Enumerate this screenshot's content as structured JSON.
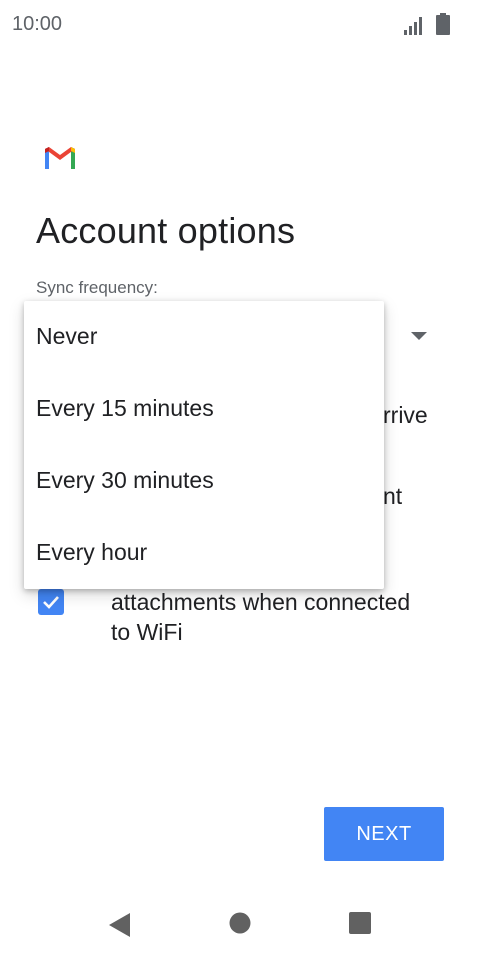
{
  "status_bar": {
    "time": "10:00"
  },
  "page": {
    "title": "Account options",
    "sync_label": "Sync frequency:"
  },
  "background": {
    "fragment_1": "rrive",
    "fragment_2": "nt",
    "checkbox_line_1": "attachments when connected",
    "checkbox_line_2": "to WiFi",
    "checkbox_checked": true
  },
  "dropdown": {
    "options": [
      "Never",
      "Every 15 minutes",
      "Every 30 minutes",
      "Every hour"
    ]
  },
  "buttons": {
    "next": "NEXT"
  },
  "colors": {
    "accent": "#4285f4",
    "text_primary": "#202124",
    "text_secondary": "#5f6368",
    "nav_icons": "#616161"
  },
  "icons": {
    "status": [
      "signal-icon",
      "battery-icon"
    ],
    "logo": "gmail-logo",
    "nav": [
      "back-icon",
      "home-icon",
      "recents-icon"
    ]
  }
}
